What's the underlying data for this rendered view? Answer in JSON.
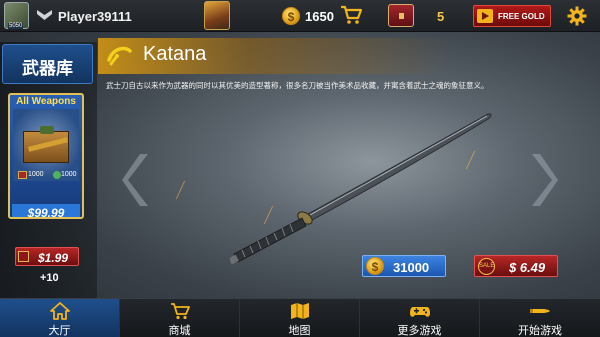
{
  "topbar": {
    "player_name": "Player39111",
    "avatar_level": "5050",
    "coins": "1650",
    "coin_symbol": "$",
    "chests": "5",
    "free_gold_label": "FREE GOLD"
  },
  "sidebar": {
    "armory_label": "武器库",
    "offer": {
      "title": "All Weapons",
      "count_left": "1000",
      "count_right": "1000",
      "price": "$99.99"
    },
    "bonus": {
      "price": "$1.99",
      "count": "+10"
    }
  },
  "weapon": {
    "name": "Katana",
    "description": "武士刀自古以来作为武器的同时以其优美的造型著称，很多名刀被当作美术品收藏，并寓含着武士之魂的象征意义。",
    "price_coins": "31000",
    "price_cash": "$ 6.49",
    "cash_tag": "SALE"
  },
  "nav": [
    {
      "label": "大厅",
      "icon": "home-icon",
      "active": true
    },
    {
      "label": "商城",
      "icon": "cart-icon",
      "active": false
    },
    {
      "label": "地图",
      "icon": "map-icon",
      "active": false
    },
    {
      "label": "更多游戏",
      "icon": "gamepad-icon",
      "active": false
    },
    {
      "label": "开始游戏",
      "icon": "bullet-icon",
      "active": false
    }
  ],
  "colors": {
    "accent_gold": "#f2b31c",
    "nav_active": "#1f4f8c",
    "cash_red": "#b82727",
    "coin_blue": "#2a77d8"
  }
}
